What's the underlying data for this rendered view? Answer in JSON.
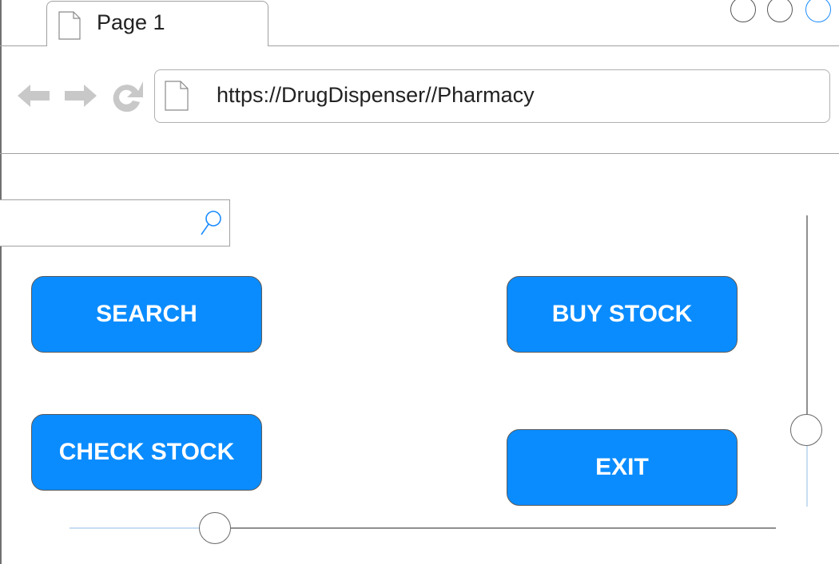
{
  "tab": {
    "label": "Page 1",
    "icon": "page-icon"
  },
  "window_controls": {
    "minimize_icon": "circle-icon",
    "maximize_icon": "circle-icon",
    "close_icon": "circle-icon",
    "accent_color": "#1a8cff"
  },
  "nav": {
    "back_icon": "arrow-left-icon",
    "forward_icon": "arrow-right-icon",
    "reload_icon": "reload-icon",
    "url": "https://DrugDispenser//Pharmacy",
    "url_icon": "page-icon"
  },
  "search": {
    "placeholder": "",
    "value": "",
    "icon": "search-icon"
  },
  "buttons": {
    "search_label": "SEARCH",
    "buy_stock_label": "BUY STOCK",
    "check_stock_label": "CHECK STOCK",
    "exit_label": "EXIT",
    "color": "#0a8cff"
  },
  "sliders": {
    "vertical_value": 0.7,
    "horizontal_value": 0.19
  }
}
